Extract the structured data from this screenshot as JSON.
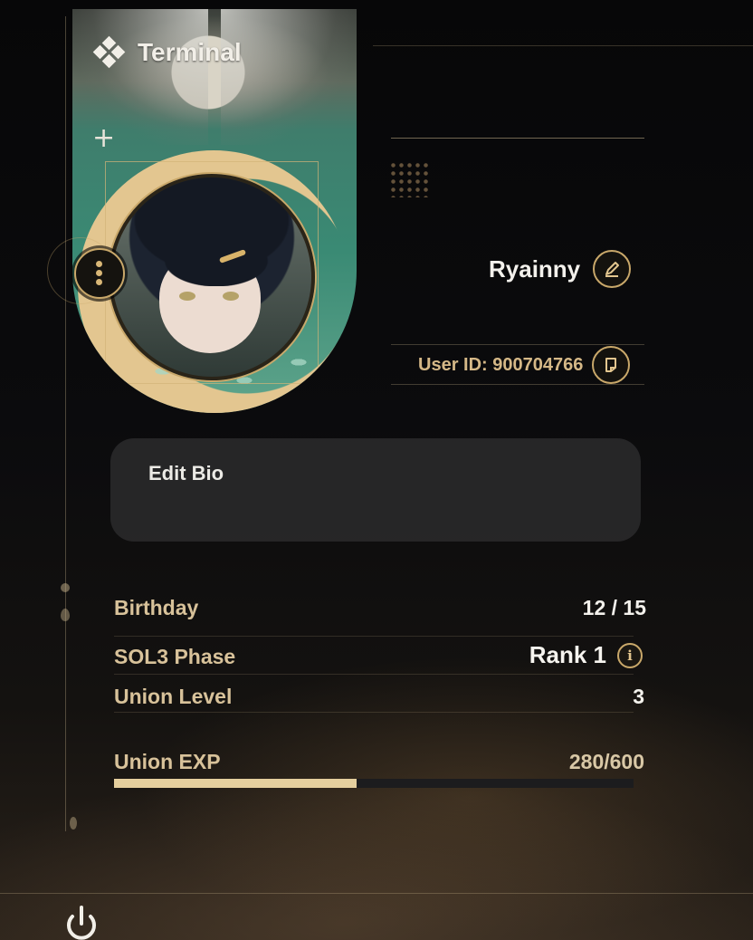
{
  "header": {
    "title": "Terminal"
  },
  "profile": {
    "name": "Ryainny",
    "user_id_label": "User ID: 900704766"
  },
  "bio": {
    "label": "Edit Bio"
  },
  "stats": {
    "birthday_label": "Birthday",
    "birthday_value": "12 / 15",
    "phase_label": "SOL3 Phase",
    "phase_value": "Rank 1",
    "union_level_label": "Union Level",
    "union_level_value": "3",
    "union_exp_label": "Union EXP",
    "union_exp_value": "280/600",
    "union_exp_fraction": 0.467
  },
  "icons": {
    "terminal": "diamond-cluster-icon",
    "menu": "vertical-dots-icon",
    "edit": "pencil-icon",
    "copy": "copy-icon",
    "info": "info-icon",
    "power": "power-icon"
  },
  "colors": {
    "accent_gold": "#c9a86a",
    "label_gold": "#d8c29a",
    "exp_fill": "#e5cf9e",
    "card_green": "#3a8a74"
  }
}
